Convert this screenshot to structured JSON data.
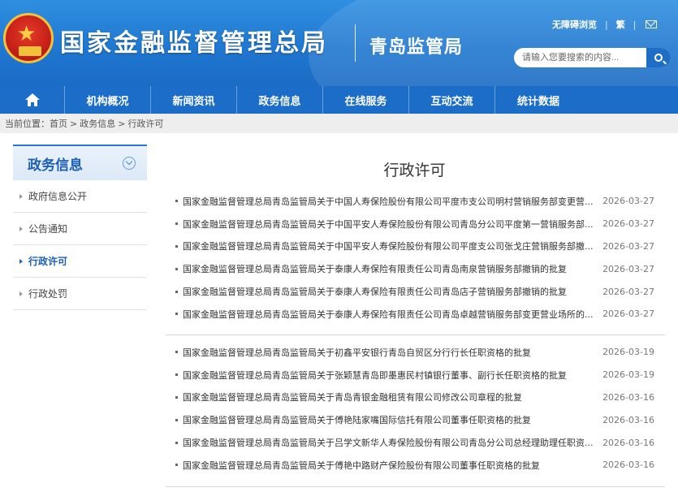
{
  "header": {
    "site_title": "国家金融监督管理总局",
    "branch_title": "青岛监管局",
    "top_links": [
      "无障碍浏览",
      "繁"
    ],
    "search_placeholder": "请输入您要搜索的内容..."
  },
  "nav": {
    "items": [
      "机构概况",
      "新闻资讯",
      "政务信息",
      "在线服务",
      "互动交流",
      "统计数据"
    ]
  },
  "breadcrumb": {
    "prefix": "当前位置：",
    "items": [
      "首页",
      "政务信息",
      "行政许可"
    ],
    "separator": ">"
  },
  "sidebar": {
    "title": "政务信息",
    "items": [
      {
        "label": "政府信息公开"
      },
      {
        "label": "公告通知"
      },
      {
        "label": "行政许可"
      },
      {
        "label": "行政处罚"
      }
    ]
  },
  "content": {
    "title": "行政许可",
    "group1": [
      {
        "title": "国家金融监督管理总局青岛监管局关于中国人寿保险股份有限公司平度市支公司明村营销服务部变更营...",
        "date": "2026-03-27"
      },
      {
        "title": "国家金融监督管理总局青岛监管局关于中国平安人寿保险股份有限公司青岛分公司平度第一营销服务部...",
        "date": "2026-03-27"
      },
      {
        "title": "国家金融监督管理总局青岛监管局关于中国平安人寿保险股份有限公司平度支公司张戈庄营销服务部撤...",
        "date": "2026-03-27"
      },
      {
        "title": "国家金融监督管理总局青岛监管局关于泰康人寿保险有限责任公司青岛南泉营销服务部撤销的批复",
        "date": "2026-03-27"
      },
      {
        "title": "国家金融监督管理总局青岛监管局关于泰康人寿保险有限责任公司青岛店子营销服务部撤销的批复",
        "date": "2026-03-27"
      },
      {
        "title": "国家金融监督管理总局青岛监管局关于泰康人寿保险有限责任公司青岛卓越营销服务部变更营业场所的...",
        "date": "2026-03-27"
      }
    ],
    "group2": [
      {
        "title": "国家金融监督管理总局青岛监管局关于初鑫平安银行青岛自贸区分行行长任职资格的批复",
        "date": "2026-03-19"
      },
      {
        "title": "国家金融监督管理总局青岛监管局关于张颖慧青岛即墨惠民村镇银行董事、副行长任职资格的批复",
        "date": "2026-03-19"
      },
      {
        "title": "国家金融监督管理总局青岛监管局关于青岛青银金融租赁有限公司修改公司章程的批复",
        "date": "2026-03-16"
      },
      {
        "title": "国家金融监督管理总局青岛监管局关于傅艳陆家嘴国际信托有限公司董事任职资格的批复",
        "date": "2026-03-16"
      },
      {
        "title": "国家金融监督管理总局青岛监管局关于吕学文新华人寿保险股份有限公司青岛分公司总经理助理任职资...",
        "date": "2026-03-16"
      },
      {
        "title": "国家金融监督管理总局青岛监管局关于傅艳中路财产保险股份有限公司董事任职资格的批复",
        "date": "2026-03-16"
      }
    ]
  }
}
